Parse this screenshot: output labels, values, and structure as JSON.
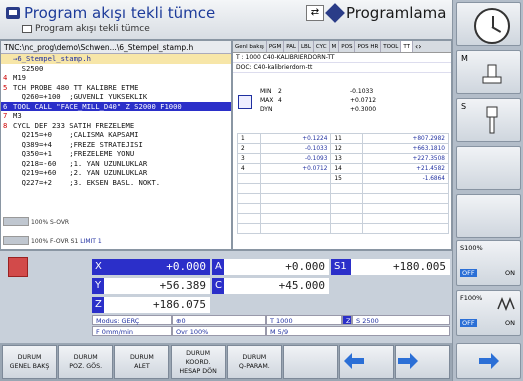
{
  "header": {
    "title": "Program akışı tekli tümce",
    "subtitle": "Program akışı tekli tümce",
    "mode_toggle_icon": "swap-arrow-icon",
    "mode_label": "Programlama"
  },
  "program": {
    "path": "TNC:\\nc_prog\\demo\\Schwen...\\6_Stempel_stamp.h",
    "lines": [
      {
        "n": "",
        "text": "→6_Stempel_stamp.h",
        "style": "cur"
      },
      {
        "n": "",
        "text": "  S2500",
        "style": ""
      },
      {
        "n": "4",
        "text": "M19",
        "style": ""
      },
      {
        "n": "5",
        "text": "TCH PROBE 480 TT KALIBRE ETME",
        "style": ""
      },
      {
        "n": "",
        "text": "  Q260=+100  ;GUVENLI YUKSEKLIK",
        "style": ""
      },
      {
        "n": "6",
        "text": "TOOL CALL \"FACE_MILL_D40\" Z S2000 F1000",
        "style": "sel"
      },
      {
        "n": "7",
        "text": "M3",
        "style": ""
      },
      {
        "n": "8",
        "text": "CYCL DEF 233 SATIH FREZELEME",
        "style": ""
      },
      {
        "n": "",
        "text": "  Q215=+0    ;CALISMA KAPSAMI",
        "style": ""
      },
      {
        "n": "",
        "text": "  Q389=+4    ;FREZE STRATEJISI",
        "style": ""
      },
      {
        "n": "",
        "text": "  Q350=+1    ;FREZELEME YONU",
        "style": ""
      },
      {
        "n": "",
        "text": "  Q218=-60   ;1. YAN UZUNLUKLAR",
        "style": ""
      },
      {
        "n": "",
        "text": "  Q219=+60   ;2. YAN UZUNLUKLAR",
        "style": ""
      },
      {
        "n": "",
        "text": "  Q227=+2    ;3. EKSEN BASL. NOKT.",
        "style": ""
      }
    ],
    "ovr_s": "100% S-OVR",
    "ovr_f": "100% F-OVR  S1",
    "ovr_f_limit": "LIMIT 1"
  },
  "tabs": [
    "Genl bakış",
    "PGM",
    "PAL",
    "LBL",
    "CYC",
    "M",
    "POS",
    "POS HR",
    "TOOL",
    "TT"
  ],
  "tt_panel": {
    "t_line": "T :  1000   C40-KALIBRIERDORN-TT",
    "doc_line": "DOC: C40-kalibrierdorn-tt",
    "min_label": "MIN",
    "min_a": "2",
    "min_b": "-0.1033",
    "max_label": "MAX",
    "max_a": "4",
    "max_b": "+0.0712",
    "dyn_label": "DYN",
    "dyn_b": "+0.3000",
    "rows": [
      [
        "1",
        "+0.1224",
        "11",
        "+807.2982"
      ],
      [
        "2",
        "-0.1033",
        "12",
        "+663.1810"
      ],
      [
        "3",
        "-0.1093",
        "13",
        "+227.3508"
      ],
      [
        "4",
        "+0.0712",
        "14",
        "+21.4582"
      ],
      [
        "",
        "",
        "15",
        "-1.6864"
      ],
      [
        "",
        "",
        "",
        ""
      ],
      [
        "",
        "",
        "",
        ""
      ],
      [
        "",
        "",
        "",
        ""
      ],
      [
        "",
        "",
        "",
        ""
      ],
      [
        "",
        "",
        "",
        ""
      ]
    ]
  },
  "positions": {
    "x_label": "X",
    "x_val": "+0.000",
    "a_label": "A",
    "a_val": "+0.000",
    "s1_label": "S1",
    "s1_val": "+180.005",
    "y_label": "Y",
    "y_val": "+56.389",
    "c_label": "C",
    "c_val": "+45.000",
    "z_label": "Z",
    "z_val": "+186.075"
  },
  "status": {
    "modus": "Modus: GERÇ",
    "zero": "⊕0",
    "tool": "T 1000",
    "spindle_axis": "Z",
    "speed": "S 2500",
    "feed": "F  0mm/min",
    "ovr": "Ovr 100%",
    "m": "M 5/9"
  },
  "right_softkeys": {
    "s100": "S100%",
    "f100": "F100%",
    "off": "OFF",
    "on": "ON",
    "m_letter": "M",
    "s_letter": "S"
  },
  "bottom_softkeys": [
    {
      "l1": "DURUM",
      "l2": "GENEL BAKŞ"
    },
    {
      "l1": "DURUM",
      "l2": "POZ. GÖS."
    },
    {
      "l1": "DURUM",
      "l2": "ALET"
    },
    {
      "l1": "DURUM",
      "l2": "KOORD.",
      "l3": "HESAP DÖN"
    },
    {
      "l1": "DURUM",
      "l2": "Q-PARAM."
    },
    {
      "l1": "",
      "l2": ""
    },
    {
      "l1": "",
      "l2": ""
    },
    {
      "l1": "",
      "l2": ""
    }
  ]
}
